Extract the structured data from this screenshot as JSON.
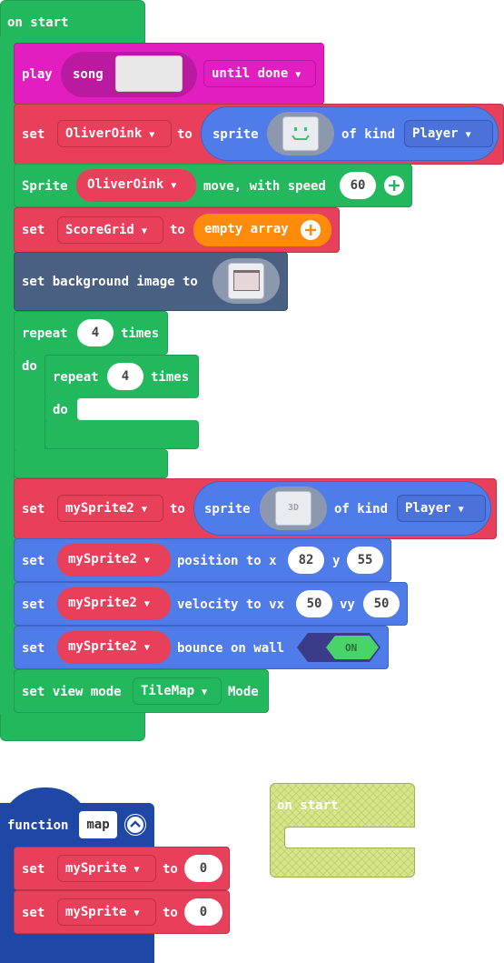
{
  "main_script": {
    "on_start_label": "on start",
    "play": {
      "label": "play",
      "song_label": "song",
      "until_label": "until done"
    },
    "set_player": {
      "set_label": "set",
      "variable": "OliverOink",
      "to_label": "to",
      "sprite_label": "sprite",
      "of_kind_label": "of kind",
      "kind": "Player"
    },
    "move": {
      "sprite_label": "Sprite",
      "variable": "OliverOink",
      "move_label": "move, with speed",
      "speed": "60"
    },
    "set_scoregrid": {
      "set_label": "set",
      "variable": "ScoreGrid",
      "to_label": "to",
      "value": "empty array"
    },
    "background": {
      "label": "set background image to"
    },
    "repeat_outer": {
      "repeat_label": "repeat",
      "count": "4",
      "times_label": "times",
      "do_label": "do"
    },
    "repeat_inner": {
      "repeat_label": "repeat",
      "count": "4",
      "times_label": "times",
      "do_label": "do"
    },
    "set_sprite2": {
      "set_label": "set",
      "variable": "mySprite2",
      "to_label": "to",
      "sprite_label": "sprite",
      "image_text": "3D",
      "of_kind_label": "of kind",
      "kind": "Player"
    },
    "position": {
      "set_label": "set",
      "variable": "mySprite2",
      "label": "position to x",
      "x": "82",
      "y_label": "y",
      "y": "55"
    },
    "velocity": {
      "set_label": "set",
      "variable": "mySprite2",
      "label": "velocity to vx",
      "vx": "50",
      "vy_label": "vy",
      "vy": "50"
    },
    "bounce": {
      "set_label": "set",
      "variable": "mySprite2",
      "label": "bounce on wall",
      "toggle": "ON"
    },
    "view_mode": {
      "label": "set view mode",
      "mode": "TileMap",
      "mode_label": "Mode"
    }
  },
  "function_block": {
    "function_label": "function",
    "name": "map",
    "rows": [
      {
        "set_label": "set",
        "variable": "mySprite",
        "to_label": "to",
        "value": "0"
      },
      {
        "set_label": "set",
        "variable": "mySprite",
        "to_label": "to",
        "value": "0"
      }
    ]
  },
  "disabled_block": {
    "label": "on start"
  },
  "colors": {
    "events_green": "#23b85e",
    "variables_red": "#e8405a",
    "sprites_blue": "#4f7ce8",
    "music_magenta": "#e31ec1",
    "scene_slate": "#4a6082",
    "arrays_orange": "#ff8b0d",
    "functions_navy": "#1f48a6",
    "disabled_hatch": "#d7e58a"
  },
  "icons": [
    "add-icon",
    "collapse-icon",
    "dropdown-caret-icon",
    "smiley-sprite-icon",
    "window-image-icon"
  ]
}
